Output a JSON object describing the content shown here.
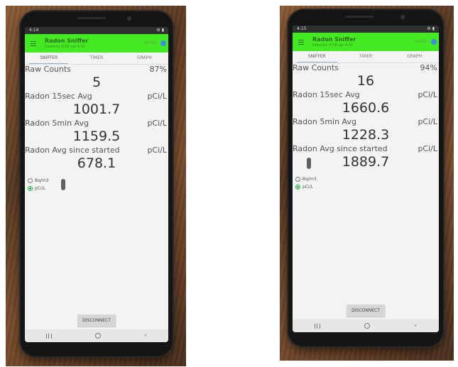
{
  "photos": [
    {
      "status_time": "4:14",
      "app": {
        "title": "Radon Sniffer",
        "subtitle": "Detector 0.58 ver 4.35",
        "more": "MORE"
      },
      "tabs": [
        "SNIFFER",
        "TIMER",
        "GRAPH"
      ],
      "raw_counts": {
        "label": "Raw Counts",
        "percent": "87%",
        "value": "5"
      },
      "avg15": {
        "label": "Radon 15sec Avg",
        "unit": "pCi/L",
        "value": "1001.7"
      },
      "avg5": {
        "label": "Radon 5min Avg",
        "unit": "pCi/L",
        "value": "1159.5"
      },
      "avg_all": {
        "label": "Radon Avg since started",
        "unit": "pCi/L",
        "value": "678.1"
      },
      "radio_options": [
        "Bq/m3",
        "pCi/L"
      ],
      "selected_unit": "pCi/L",
      "disconnect": "DISCONNECT"
    },
    {
      "status_time": "4:15",
      "app": {
        "title": "Radon Sniffer",
        "subtitle": "Detector 0.58 ver 4.35",
        "more": "MORE"
      },
      "tabs": [
        "SNIFFER",
        "TIMER",
        "GRAPH"
      ],
      "raw_counts": {
        "label": "Raw Counts",
        "percent": "94%",
        "value": "16"
      },
      "avg15": {
        "label": "Radon 15sec Avg",
        "unit": "pCi/L",
        "value": "1660.6"
      },
      "avg5": {
        "label": "Radon 5min Avg",
        "unit": "pCi/L",
        "value": "1228.3"
      },
      "avg_all": {
        "label": "Radon Avg since started",
        "unit": "pCi/L",
        "value": "1889.7"
      },
      "radio_options": [
        "Bq/m3",
        "pCi/L"
      ],
      "selected_unit": "pCi/L",
      "disconnect": "DISCONNECT"
    }
  ],
  "colors": {
    "appbar": "#44ea21",
    "accent_radio": "#24b24a",
    "blue_dot": "#3a8fe0"
  }
}
